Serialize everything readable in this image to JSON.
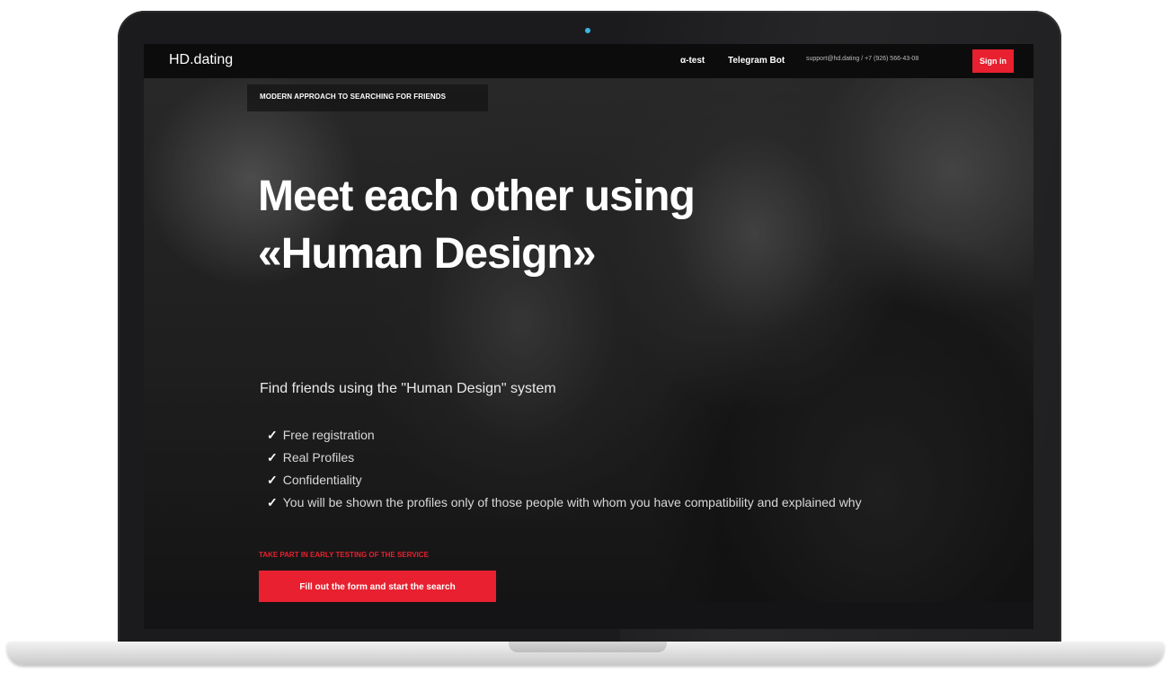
{
  "colors": {
    "accent": "#e8202f",
    "navbar": "#0c0c0c",
    "laptop_frame": "#1b1b1d"
  },
  "header": {
    "logo": "HD.dating",
    "nav": {
      "alpha_test": "α-test",
      "telegram_bot": "Telegram Bot",
      "contact": "support@hd.dating / +7 (926) 566-43-08"
    },
    "signin_label": "Sign in"
  },
  "hero": {
    "tagline": "MODERN APPROACH TO SEARCHING FOR FRIENDS",
    "headline_line1": "Meet each other using",
    "headline_line2": "«Human Design»",
    "subtitle": "Find friends using the \"Human Design\" system",
    "features": [
      "Free registration",
      "Real Profiles",
      "Confidentiality",
      "You will be shown the profiles only of those people with whom you have compatibility and explained why"
    ],
    "check_icon": "✓",
    "early_testing": "TAKE PART IN EARLY TESTING OF THE SERVICE",
    "cta_label": "Fill out the form and start the search"
  }
}
